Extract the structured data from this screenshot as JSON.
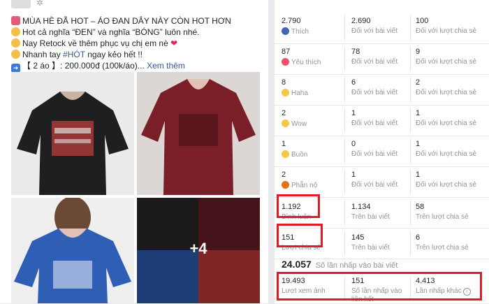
{
  "post": {
    "lines": [
      "MÙA HÈ ĐÃ HOT – ÁO ĐAN DÂY NÀY CÒN HOT HƠN",
      "Hot cả nghĩa “ĐEN” và nghĩa “BÓNG” luôn nhé.",
      "Nay Retock về thêm phục vụ chị em nè",
      "Nhanh tay",
      "ngay kẻo hết !!",
      "【 2 áo 】: 200.000đ (100k/áo)..."
    ],
    "hashtag": "#HÓT",
    "see_more": "Xem thêm",
    "more_photos": "+4"
  },
  "stats": {
    "reactions": [
      {
        "name": "Thích",
        "total": "2.790",
        "on_post": "2.690",
        "on_shares": "100",
        "icon": "like-icon"
      },
      {
        "name": "Yêu thích",
        "total": "87",
        "on_post": "78",
        "on_shares": "9",
        "icon": "love-icon"
      },
      {
        "name": "Haha",
        "total": "8",
        "on_post": "6",
        "on_shares": "2",
        "icon": "haha-icon"
      },
      {
        "name": "Wow",
        "total": "2",
        "on_post": "1",
        "on_shares": "1",
        "icon": "wow-icon"
      },
      {
        "name": "Buồn",
        "total": "1",
        "on_post": "0",
        "on_shares": "1",
        "icon": "sad-icon"
      },
      {
        "name": "Phẫn nộ",
        "total": "2",
        "on_post": "1",
        "on_shares": "1",
        "icon": "angry-icon"
      }
    ],
    "col_on_post": "Đối với bài viết",
    "col_on_shares": "Đối với lượt chia sẻ",
    "comments": {
      "label": "Bình luận",
      "total": "1.192",
      "on_post": "1.134",
      "on_post_label": "Trên bài viết",
      "on_shares": "58",
      "on_shares_label": "Trên lượt chia sẻ"
    },
    "shares": {
      "label": "Lượt chia sẻ",
      "total": "151",
      "on_post": "145",
      "on_post_label": "Trên bài viết",
      "on_shares": "6",
      "on_shares_label": "Trên lượt chia sẻ"
    },
    "clicks_total": {
      "value": "24.057",
      "label": "Số lần nhấp vào bài viết"
    },
    "clicks": {
      "photo_views": {
        "value": "19.493",
        "label": "Lượt xem ảnh"
      },
      "link_clicks": {
        "value": "151",
        "label": "Số lần nhấp vào liên kết"
      },
      "other_clicks": {
        "value": "4.413",
        "label": "Lần nhấp khác"
      }
    }
  },
  "colors": {
    "highlight": "#e01b24",
    "link": "#365899",
    "like": "#4267b2",
    "love": "#f25268"
  }
}
